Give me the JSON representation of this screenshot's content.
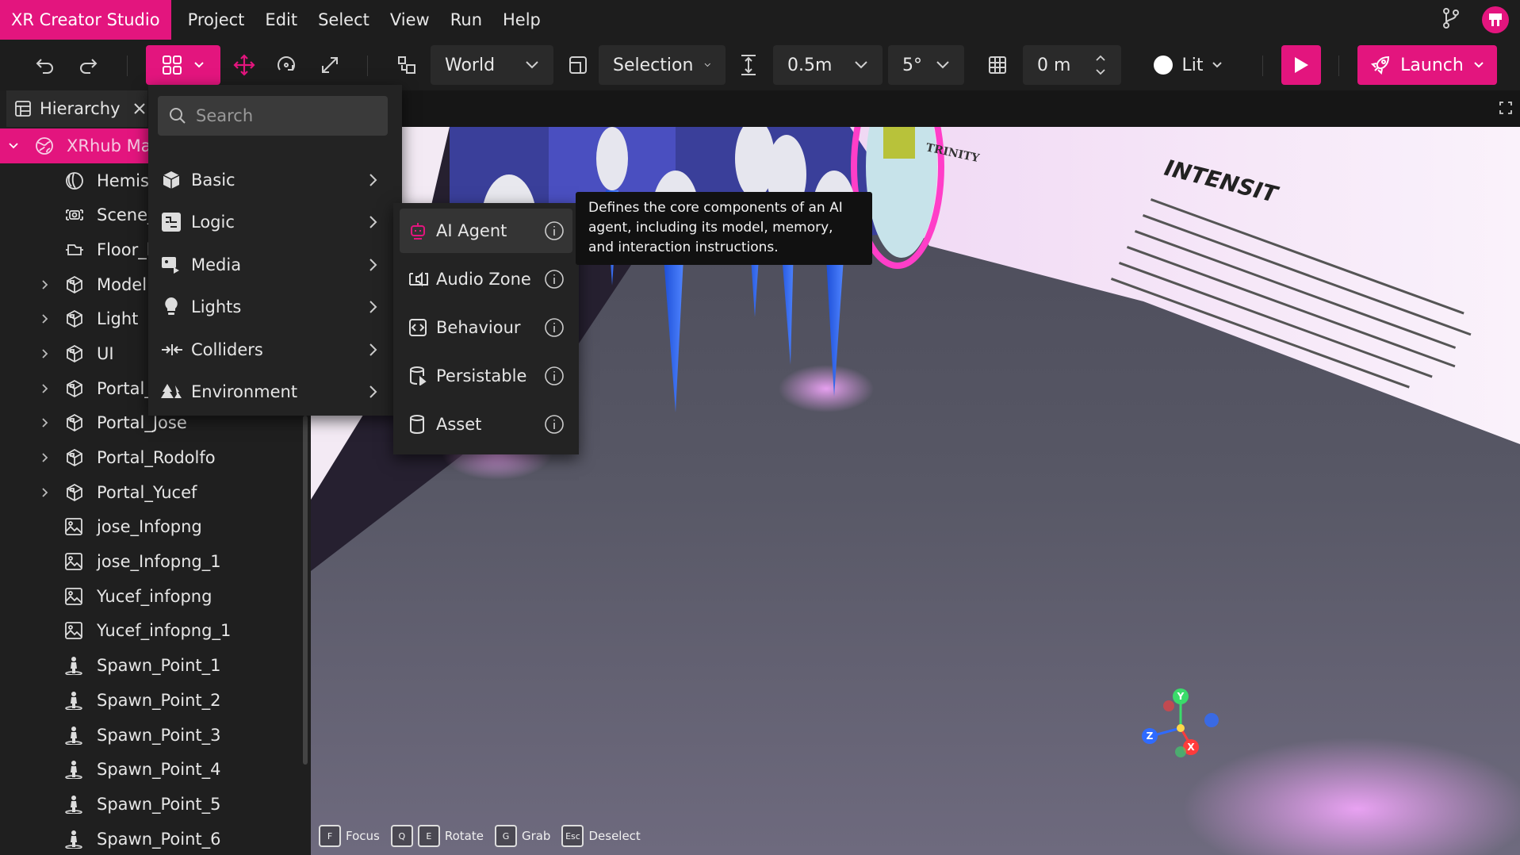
{
  "menubar": {
    "brand": "XR Creator Studio",
    "items": [
      "Project",
      "Edit",
      "Select",
      "View",
      "Run",
      "Help"
    ]
  },
  "toolbar": {
    "space": "World",
    "pivot": "Selection",
    "translate_snap": "0.5m",
    "rotate_snap": "5°",
    "grid_height": "0 m",
    "render_mode": "Lit",
    "launch": "Launch"
  },
  "hierarchy": {
    "tab": "Hierarchy",
    "items": [
      {
        "label": "XRhub Ma",
        "icon": "globe-icon",
        "caret": "down",
        "selected": true,
        "indent": 0
      },
      {
        "label": "Hemis",
        "icon": "hemisphere-light-icon",
        "caret": "",
        "indent": 1
      },
      {
        "label": "Scene_",
        "icon": "camera-icon",
        "caret": "",
        "indent": 1
      },
      {
        "label": "Floor_l",
        "icon": "floor-plan-icon",
        "caret": "",
        "indent": 1
      },
      {
        "label": "Model",
        "icon": "model-icon",
        "caret": "right",
        "indent": 1
      },
      {
        "label": "Light",
        "icon": "model-icon",
        "caret": "right",
        "indent": 1
      },
      {
        "label": "UI",
        "icon": "model-icon",
        "caret": "right",
        "indent": 1
      },
      {
        "label": "Portal_",
        "icon": "model-icon",
        "caret": "right",
        "indent": 1
      },
      {
        "label": "Portal_Jose",
        "icon": "model-icon",
        "caret": "right",
        "indent": 1
      },
      {
        "label": "Portal_Rodolfo",
        "icon": "model-icon",
        "caret": "right",
        "indent": 1
      },
      {
        "label": "Portal_Yucef",
        "icon": "model-icon",
        "caret": "right",
        "indent": 1
      },
      {
        "label": "jose_Infopng",
        "icon": "image-icon",
        "caret": "",
        "indent": 1
      },
      {
        "label": "jose_Infopng_1",
        "icon": "image-icon",
        "caret": "",
        "indent": 1
      },
      {
        "label": "Yucef_infopng",
        "icon": "image-icon",
        "caret": "",
        "indent": 1
      },
      {
        "label": "Yucef_infopng_1",
        "icon": "image-icon",
        "caret": "",
        "indent": 1
      },
      {
        "label": "Spawn_Point_1",
        "icon": "spawn-point-icon",
        "caret": "",
        "indent": 1
      },
      {
        "label": "Spawn_Point_2",
        "icon": "spawn-point-icon",
        "caret": "",
        "indent": 1
      },
      {
        "label": "Spawn_Point_3",
        "icon": "spawn-point-icon",
        "caret": "",
        "indent": 1
      },
      {
        "label": "Spawn_Point_4",
        "icon": "spawn-point-icon",
        "caret": "",
        "indent": 1
      },
      {
        "label": "Spawn_Point_5",
        "icon": "spawn-point-icon",
        "caret": "",
        "indent": 1
      },
      {
        "label": "Spawn_Point_6",
        "icon": "spawn-point-icon",
        "caret": "",
        "indent": 1
      }
    ]
  },
  "add_menu": {
    "search_placeholder": "Search",
    "categories": [
      "Basic",
      "Logic",
      "Media",
      "Lights",
      "Colliders",
      "Environment"
    ],
    "logic_items": [
      "AI Agent",
      "Audio Zone",
      "Behaviour",
      "Persistable",
      "Asset"
    ],
    "tooltip": "Defines the core components of an AI agent, including its model, memory, and interaction instructions."
  },
  "scene": {
    "wall_texts": [
      "TRINITY",
      "INTENSIT"
    ]
  },
  "viewport_hints": [
    {
      "key": "F",
      "label": "Focus"
    },
    {
      "key": "Q",
      "label": ""
    },
    {
      "key": "E",
      "label": "Rotate"
    },
    {
      "key": "G",
      "label": "Grab"
    },
    {
      "key": "Esc",
      "label": "Deselect"
    }
  ],
  "gizmo": {
    "x": "X",
    "y": "Y",
    "z": "Z"
  },
  "colors": {
    "accent": "#e3157e",
    "panel": "#1f1f1f",
    "menu": "#232323"
  }
}
